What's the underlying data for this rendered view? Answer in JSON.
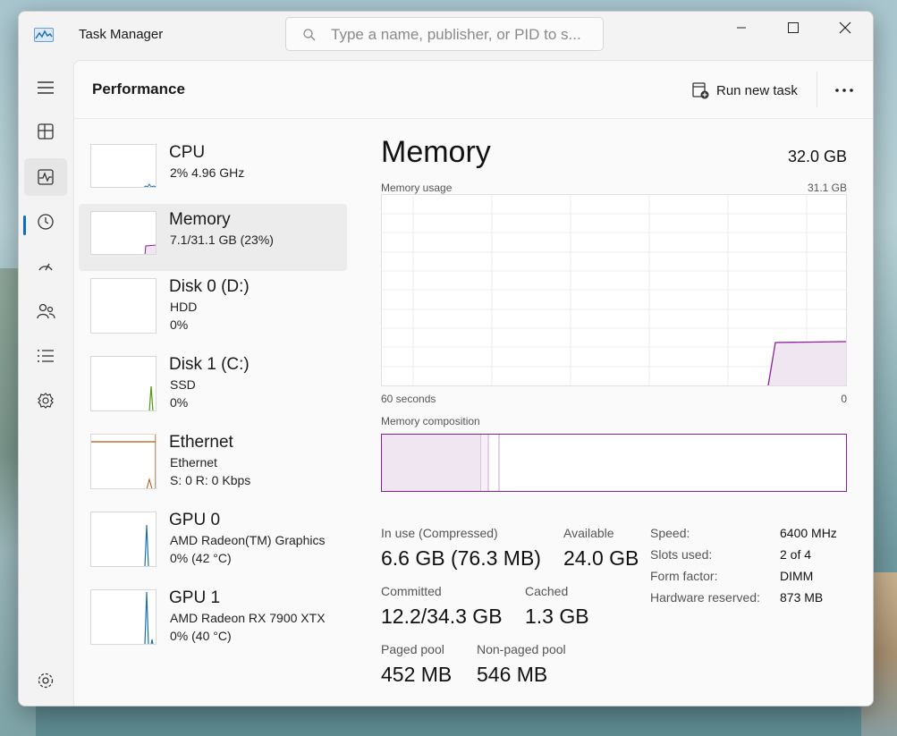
{
  "window": {
    "title": "Task Manager",
    "search_placeholder": "Type a name, publisher, or PID to s..."
  },
  "nav": {
    "items": [
      {
        "name": "hamburger-menu-icon"
      },
      {
        "name": "processes-icon"
      },
      {
        "name": "performance-icon",
        "active": true
      },
      {
        "name": "app-history-icon"
      },
      {
        "name": "startup-apps-icon"
      },
      {
        "name": "users-icon"
      },
      {
        "name": "details-icon"
      },
      {
        "name": "services-icon"
      }
    ],
    "settings": "settings-icon"
  },
  "header": {
    "title": "Performance",
    "run_new_task": "Run new task",
    "more": "..."
  },
  "resources": [
    {
      "name": "CPU",
      "line1": "2% 4.96 GHz",
      "line2": "",
      "color": "#1f6fb0",
      "selected": false
    },
    {
      "name": "Memory",
      "line1": "7.1/31.1 GB (23%)",
      "line2": "",
      "color": "#8b1f9b",
      "selected": true
    },
    {
      "name": "Disk 0 (D:)",
      "line1": "HDD",
      "line2": "0%",
      "color": "#4d9a06",
      "selected": false
    },
    {
      "name": "Disk 1 (C:)",
      "line1": "SSD",
      "line2": "0%",
      "color": "#4d9a06",
      "selected": false
    },
    {
      "name": "Ethernet",
      "line1": "Ethernet",
      "line2": "S: 0 R: 0 Kbps",
      "color": "#b5530d",
      "selected": false
    },
    {
      "name": "GPU 0",
      "line1": "AMD Radeon(TM) Graphics",
      "line2": "0% (42 °C)",
      "color": "#1f6fb0",
      "selected": false
    },
    {
      "name": "GPU 1",
      "line1": "AMD Radeon RX 7900 XTX",
      "line2": "0% (40 °C)",
      "color": "#1f6fb0",
      "selected": false
    }
  ],
  "memory": {
    "title": "Memory",
    "total": "32.0 GB",
    "usage_label": "Memory usage",
    "usage_max": "31.1 GB",
    "x_left": "60 seconds",
    "x_right": "0",
    "composition_label": "Memory composition",
    "accent": "#8b1f9b",
    "stats": {
      "in_use_label": "In use (Compressed)",
      "in_use_value": "6.6 GB (76.3 MB)",
      "available_label": "Available",
      "available_value": "24.0 GB",
      "committed_label": "Committed",
      "committed_value": "12.2/34.3 GB",
      "cached_label": "Cached",
      "cached_value": "1.3 GB",
      "paged_label": "Paged pool",
      "paged_value": "452 MB",
      "nonpaged_label": "Non-paged pool",
      "nonpaged_value": "546 MB"
    },
    "specs": {
      "speed_label": "Speed:",
      "speed_value": "6400 MHz",
      "slots_label": "Slots used:",
      "slots_value": "2 of 4",
      "form_label": "Form factor:",
      "form_value": "DIMM",
      "reserved_label": "Hardware reserved:",
      "reserved_value": "873 MB"
    }
  }
}
